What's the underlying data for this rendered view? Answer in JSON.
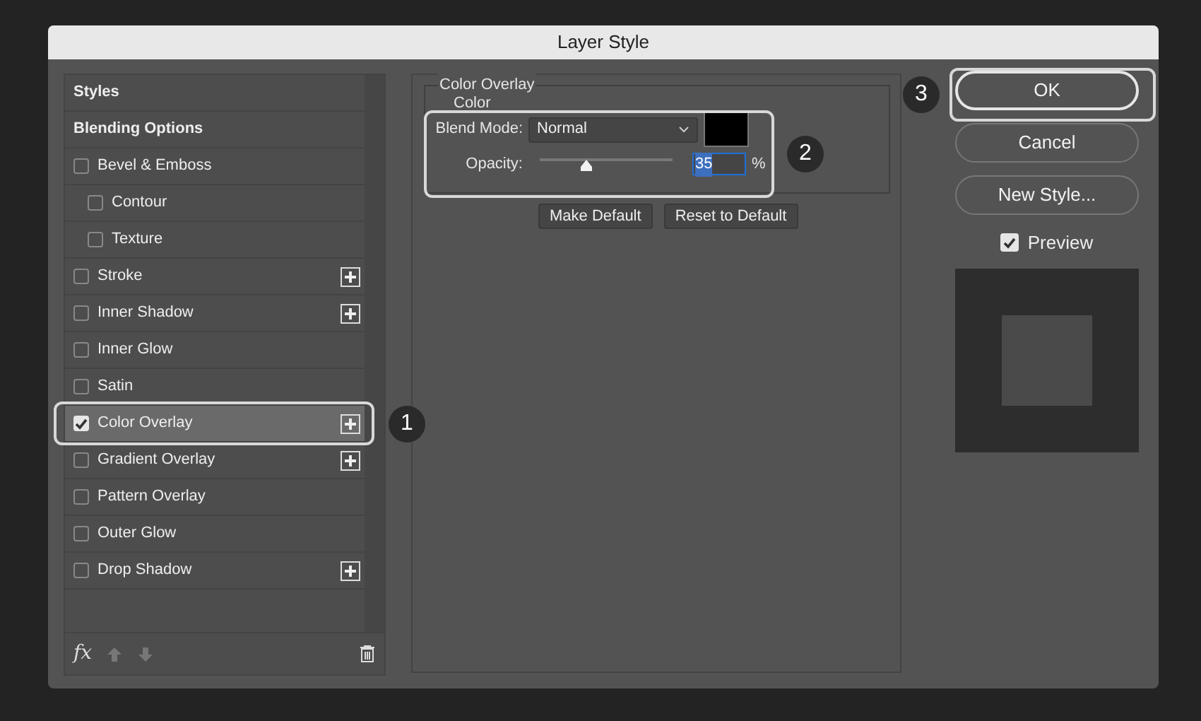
{
  "window": {
    "title": "Layer Style"
  },
  "styles_list": {
    "items": [
      {
        "label": "Styles",
        "kind": "header",
        "selected": false
      },
      {
        "label": "Blending Options",
        "kind": "header",
        "selected": false
      },
      {
        "label": "Bevel & Emboss",
        "kind": "effect",
        "checked": false,
        "addable": false,
        "selected": false,
        "children": [
          {
            "label": "Contour",
            "kind": "effect",
            "checked": false,
            "addable": false,
            "selected": false
          },
          {
            "label": "Texture",
            "kind": "effect",
            "checked": false,
            "addable": false,
            "selected": false
          }
        ]
      },
      {
        "label": "Stroke",
        "kind": "effect",
        "checked": false,
        "addable": true,
        "selected": false
      },
      {
        "label": "Inner Shadow",
        "kind": "effect",
        "checked": false,
        "addable": true,
        "selected": false
      },
      {
        "label": "Inner Glow",
        "kind": "effect",
        "checked": false,
        "addable": false,
        "selected": false
      },
      {
        "label": "Satin",
        "kind": "effect",
        "checked": false,
        "addable": false,
        "selected": false
      },
      {
        "label": "Color Overlay",
        "kind": "effect",
        "checked": true,
        "addable": true,
        "selected": true,
        "callout": "1"
      },
      {
        "label": "Gradient Overlay",
        "kind": "effect",
        "checked": false,
        "addable": true,
        "selected": false
      },
      {
        "label": "Pattern Overlay",
        "kind": "effect",
        "checked": false,
        "addable": false,
        "selected": false
      },
      {
        "label": "Outer Glow",
        "kind": "effect",
        "checked": false,
        "addable": false,
        "selected": false
      },
      {
        "label": "Drop Shadow",
        "kind": "effect",
        "checked": false,
        "addable": true,
        "selected": false
      }
    ],
    "footer": {
      "fx": "fx"
    }
  },
  "panel": {
    "title": "Color Overlay",
    "group": "Color",
    "callout": "2",
    "blend_mode": {
      "label": "Blend Mode:",
      "value": "Normal",
      "color": "#000000"
    },
    "opacity": {
      "label": "Opacity:",
      "level": 0.35,
      "value": "35",
      "unit": "%"
    },
    "buttons": [
      "Make Default",
      "Reset to Default"
    ]
  },
  "side": {
    "buttons": [
      {
        "label": "OK",
        "default": true,
        "callout": "3"
      },
      {
        "label": "Cancel",
        "default": false
      },
      {
        "label": "New Style...",
        "default": false
      }
    ],
    "preview": {
      "label": "Preview",
      "checked": true
    }
  }
}
